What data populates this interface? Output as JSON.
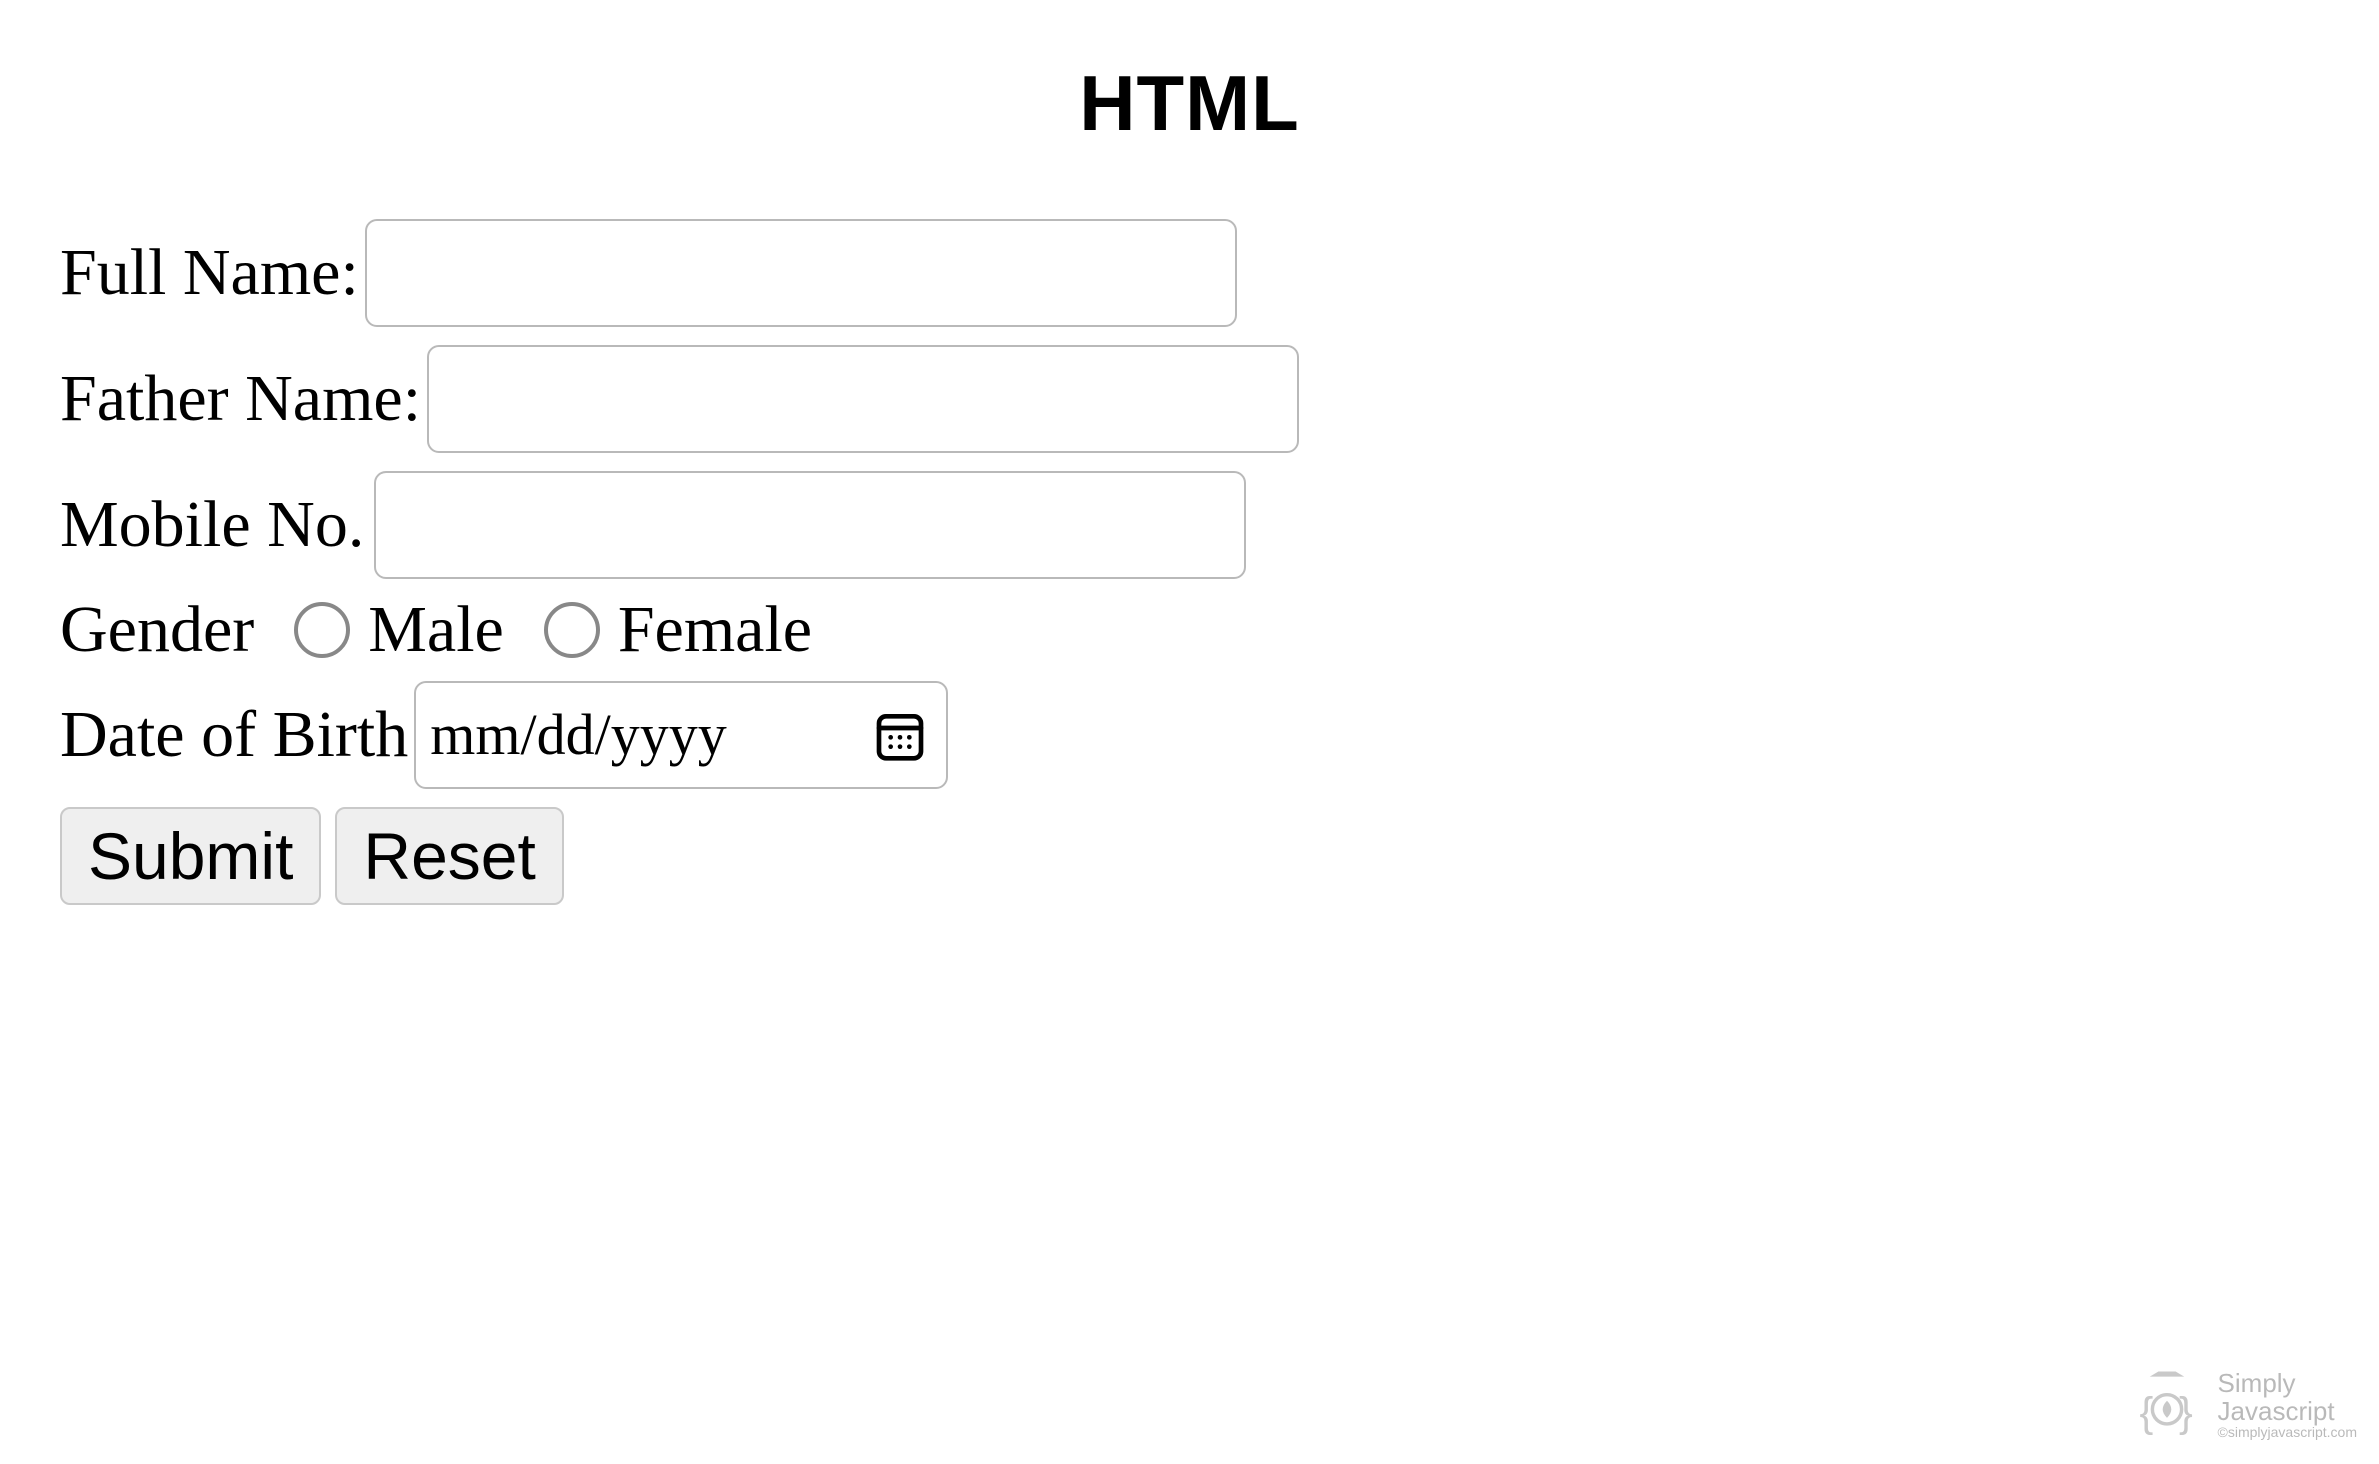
{
  "title": "HTML",
  "form": {
    "fullName": {
      "label": "Full Name:",
      "value": ""
    },
    "fatherName": {
      "label": "Father Name:",
      "value": ""
    },
    "mobile": {
      "label": "Mobile No.",
      "value": ""
    },
    "gender": {
      "label": "Gender",
      "options": {
        "male": "Male",
        "female": "Female"
      },
      "selected": ""
    },
    "dob": {
      "label": "Date of Birth",
      "placeholder": "mm/dd/yyyy",
      "value": ""
    },
    "buttons": {
      "submit": "Submit",
      "reset": "Reset"
    }
  },
  "watermark": {
    "line1": "Simply",
    "line2": "Javascript",
    "line3": "©simplyjavascript.com"
  }
}
